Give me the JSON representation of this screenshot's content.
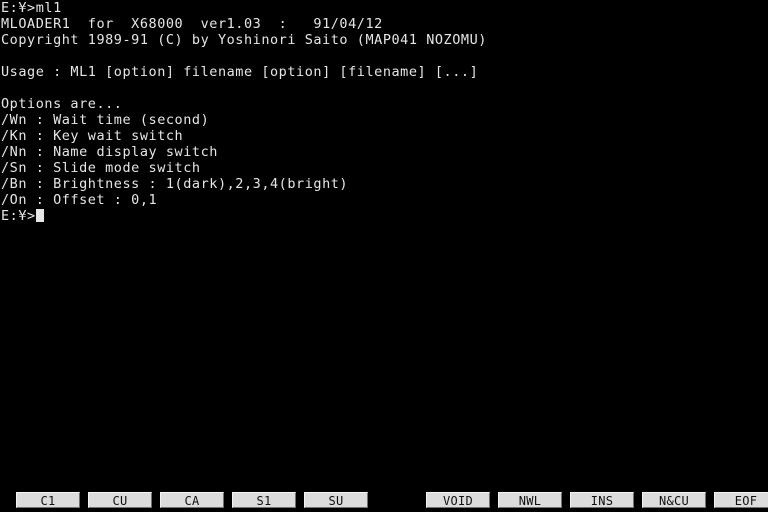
{
  "terminal": {
    "title": "Human68k Command Shell",
    "background_color": "#000000",
    "text_color": "#e6e6e6",
    "command_line": "E:\\u00a5>ml1",
    "lines": [
      "E:¥>ml1",
      "MLOADER1  for  X68000  ver1.03  :   91/04/12",
      "Copyright 1989-91 (C) by Yoshinori Saito (MAP041 NOZOMU)",
      "",
      "Usage : ML1 [option] filename [option] [filename] [...]",
      "",
      "Options are...",
      "/Wn : Wait time (second)",
      "/Kn : Key wait switch",
      "/Nn : Name display switch",
      "/Sn : Slide mode switch",
      "/Bn : Brightness : 1(dark),2,3,4(bright)",
      "/On : Offset : 0,1"
    ],
    "prompt": "E:¥>",
    "cursor": "block"
  },
  "function_keys": {
    "background_color": "#dcdcdc",
    "label_color": "#101010",
    "group_left": [
      {
        "label": "C1"
      },
      {
        "label": "CU"
      },
      {
        "label": "CA"
      },
      {
        "label": "S1"
      },
      {
        "label": "SU"
      }
    ],
    "group_right": [
      {
        "label": "VOID"
      },
      {
        "label": "NWL"
      },
      {
        "label": "INS"
      },
      {
        "label": "N&CU"
      },
      {
        "label": "EOF"
      }
    ]
  }
}
